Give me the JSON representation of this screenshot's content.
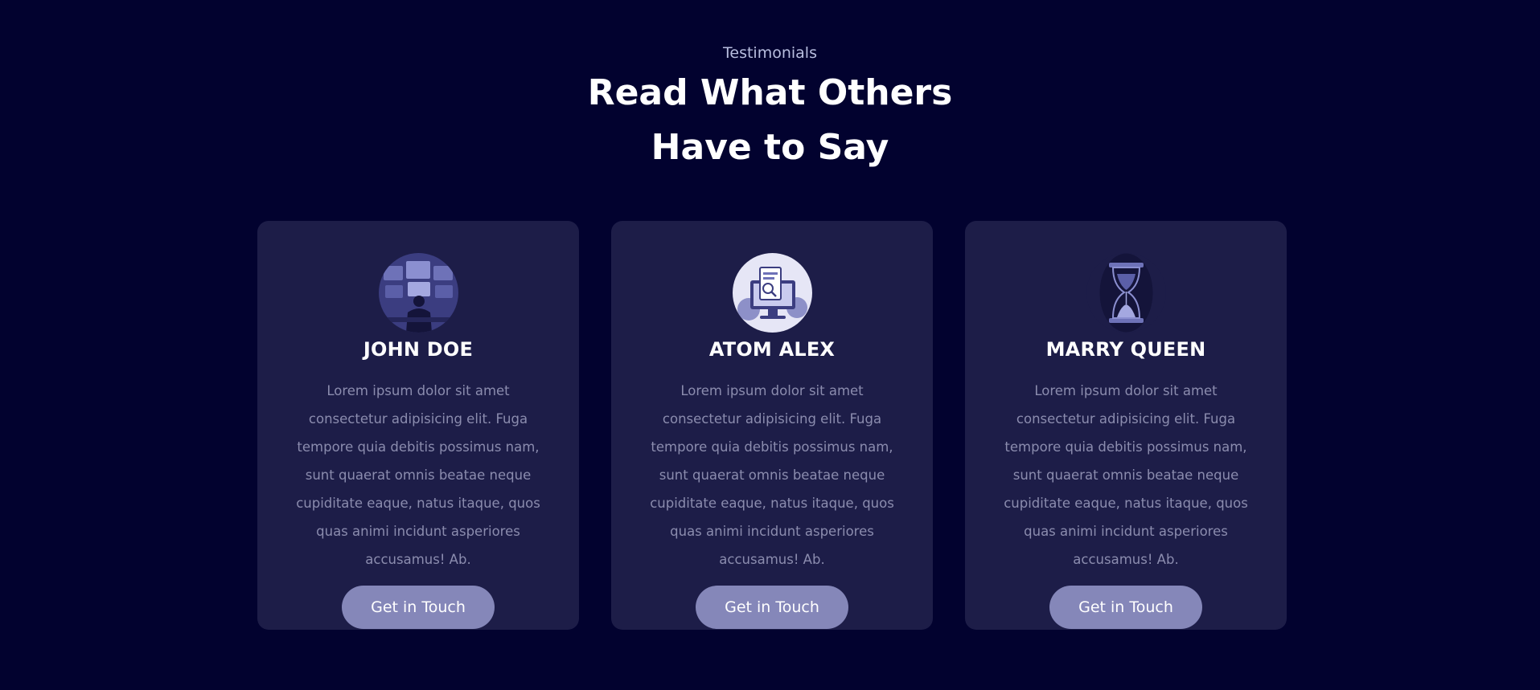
{
  "section": {
    "eyebrow": "Testimonials",
    "title_line1": "Read What Others",
    "title_line2": "Have to Say"
  },
  "colors": {
    "background": "#02022f",
    "card": "#1d1d48",
    "button": "#8587b9",
    "body_text": "#8b8cae"
  },
  "testimonials": [
    {
      "name": "JOHN DOE",
      "avatar": "person-at-monitors-icon",
      "text": "Lorem ipsum dolor sit amet consectetur adipisicing elit. Fuga tempore quia debitis possimus nam, sunt quaerat omnis beatae neque cupiditate eaque, natus itaque, quos quas animi incidunt asperiores accusamus! Ab.",
      "button": "Get in Touch"
    },
    {
      "name": "ATOM ALEX",
      "avatar": "computer-document-icon",
      "text": "Lorem ipsum dolor sit amet consectetur adipisicing elit. Fuga tempore quia debitis possimus nam, sunt quaerat omnis beatae neque cupiditate eaque, natus itaque, quos quas animi incidunt asperiores accusamus! Ab.",
      "button": "Get in Touch"
    },
    {
      "name": "MARRY QUEEN",
      "avatar": "hourglass-icon",
      "text": "Lorem ipsum dolor sit amet consectetur adipisicing elit. Fuga tempore quia debitis possimus nam, sunt quaerat omnis beatae neque cupiditate eaque, natus itaque, quos quas animi incidunt asperiores accusamus! Ab.",
      "button": "Get in Touch"
    }
  ]
}
